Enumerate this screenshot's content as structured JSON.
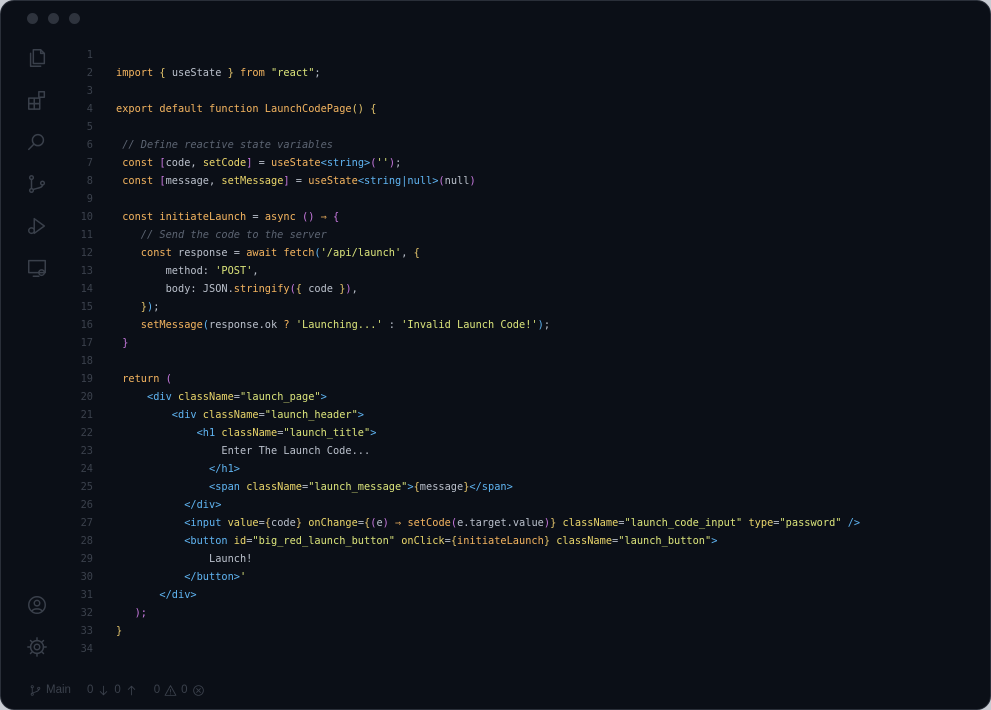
{
  "status": {
    "branch": "Main",
    "incoming": "0",
    "outgoing": "0",
    "warnings": "0",
    "errors": "0"
  },
  "editor": {
    "line_numbers": [
      "1",
      "2",
      "3",
      "4",
      "5",
      "6",
      "7",
      "8",
      "9",
      "10",
      "11",
      "12",
      "13",
      "14",
      "15",
      "16",
      "17",
      "18",
      "19",
      "20",
      "21",
      "22",
      "23",
      "24",
      "25",
      "26",
      "27",
      "28",
      "29",
      "30",
      "31",
      "32",
      "33",
      "34"
    ],
    "lines": [
      [],
      [
        [
          "kw",
          "import "
        ],
        [
          "br1",
          "{ "
        ],
        [
          "pl",
          "useState "
        ],
        [
          "br1",
          "} "
        ],
        [
          "kw",
          "from "
        ],
        [
          "str",
          "\"react\""
        ],
        [
          "pl",
          ";"
        ]
      ],
      [],
      [
        [
          "kw",
          "export default function "
        ],
        [
          "fn",
          "LaunchCodePage"
        ],
        [
          "br1",
          "() {"
        ]
      ],
      [],
      [
        [
          "cmt",
          " // Define reactive state variables"
        ]
      ],
      [
        [
          "kw",
          " const "
        ],
        [
          "br2",
          "["
        ],
        [
          "pl",
          "code, "
        ],
        [
          "attr",
          "setCode"
        ],
        [
          "br2",
          "]"
        ],
        [
          "pl",
          " = "
        ],
        [
          "fn",
          "useState"
        ],
        [
          "type",
          "<string>"
        ],
        [
          "br2",
          "("
        ],
        [
          "str",
          "''"
        ],
        [
          "br2",
          ")"
        ],
        [
          "pl",
          ";"
        ]
      ],
      [
        [
          "kw",
          " const "
        ],
        [
          "br2",
          "["
        ],
        [
          "pl",
          "message, "
        ],
        [
          "attr",
          "setMessage"
        ],
        [
          "br2",
          "]"
        ],
        [
          "pl",
          " = "
        ],
        [
          "fn",
          "useState"
        ],
        [
          "type",
          "<string|null>"
        ],
        [
          "br2",
          "("
        ],
        [
          "pl",
          "null"
        ],
        [
          "br2",
          ")"
        ]
      ],
      [],
      [
        [
          "kw",
          " const "
        ],
        [
          "fn",
          "initiateLaunch"
        ],
        [
          "pl",
          " = "
        ],
        [
          "kw",
          "async "
        ],
        [
          "br2",
          "() "
        ],
        [
          "kw",
          "⇒ "
        ],
        [
          "br2",
          "{"
        ]
      ],
      [
        [
          "cmt",
          "    // Send the code to the server"
        ]
      ],
      [
        [
          "kw",
          "    const "
        ],
        [
          "pl",
          "response = "
        ],
        [
          "kw",
          "await "
        ],
        [
          "fn",
          "fetch"
        ],
        [
          "br3",
          "("
        ],
        [
          "str",
          "'/api/launch'"
        ],
        [
          "pl",
          ", "
        ],
        [
          "br1",
          "{"
        ]
      ],
      [
        [
          "pl",
          "        method: "
        ],
        [
          "str",
          "'POST'"
        ],
        [
          "pl",
          ","
        ]
      ],
      [
        [
          "pl",
          "        body: JSON."
        ],
        [
          "fn",
          "stringify"
        ],
        [
          "br2",
          "("
        ],
        [
          "br1",
          "{ "
        ],
        [
          "pl",
          "code "
        ],
        [
          "br1",
          "}"
        ],
        [
          "br2",
          ")"
        ],
        [
          "pl",
          ","
        ]
      ],
      [
        [
          "br1",
          "    }"
        ],
        [
          "br3",
          ")"
        ],
        [
          "pl",
          ";"
        ]
      ],
      [
        [
          "fn",
          "    setMessage"
        ],
        [
          "br3",
          "("
        ],
        [
          "pl",
          "response.ok "
        ],
        [
          "kw",
          "? "
        ],
        [
          "str",
          "'Launching...'"
        ],
        [
          "pl",
          " : "
        ],
        [
          "str",
          "'Invalid Launch Code!'"
        ],
        [
          "br3",
          ")"
        ],
        [
          "pl",
          ";"
        ]
      ],
      [
        [
          "br2",
          " }"
        ]
      ],
      [],
      [
        [
          "kw",
          " return "
        ],
        [
          "br2",
          "("
        ]
      ],
      [
        [
          "tag",
          "     <div "
        ],
        [
          "attr",
          "className"
        ],
        [
          "pl",
          "="
        ],
        [
          "str",
          "\"launch_page\""
        ],
        [
          "tag",
          ">"
        ]
      ],
      [
        [
          "tag",
          "         <div "
        ],
        [
          "attr",
          "className"
        ],
        [
          "pl",
          "="
        ],
        [
          "str",
          "\"launch_header\""
        ],
        [
          "tag",
          ">"
        ]
      ],
      [
        [
          "tag",
          "             <h1 "
        ],
        [
          "attr",
          "className"
        ],
        [
          "pl",
          "="
        ],
        [
          "str",
          "\"launch_title\""
        ],
        [
          "tag",
          ">"
        ]
      ],
      [
        [
          "pl",
          "                 Enter The Launch Code..."
        ]
      ],
      [
        [
          "tag",
          "               </h1>"
        ]
      ],
      [
        [
          "tag",
          "               <span "
        ],
        [
          "attr",
          "className"
        ],
        [
          "pl",
          "="
        ],
        [
          "str",
          "\"launch_message\""
        ],
        [
          "tag",
          ">"
        ],
        [
          "br1",
          "{"
        ],
        [
          "pl",
          "message"
        ],
        [
          "br1",
          "}"
        ],
        [
          "tag",
          "</span>"
        ]
      ],
      [
        [
          "tag",
          "           </div>"
        ]
      ],
      [
        [
          "tag",
          "           <input "
        ],
        [
          "attr",
          "value"
        ],
        [
          "pl",
          "="
        ],
        [
          "br1",
          "{"
        ],
        [
          "pl",
          "code"
        ],
        [
          "br1",
          "} "
        ],
        [
          "attr",
          "onChange"
        ],
        [
          "pl",
          "="
        ],
        [
          "br1",
          "{"
        ],
        [
          "br2",
          "("
        ],
        [
          "pl",
          "e"
        ],
        [
          "br2",
          ") "
        ],
        [
          "kw",
          "⇒ "
        ],
        [
          "fn",
          "setCode"
        ],
        [
          "br2",
          "("
        ],
        [
          "pl",
          "e.target.value"
        ],
        [
          "br2",
          ")"
        ],
        [
          "br1",
          "} "
        ],
        [
          "attr",
          "className"
        ],
        [
          "pl",
          "="
        ],
        [
          "str",
          "\"launch_code_input\" "
        ],
        [
          "attr",
          "type"
        ],
        [
          "pl",
          "="
        ],
        [
          "str",
          "\"password\" "
        ],
        [
          "tag",
          "/>"
        ]
      ],
      [
        [
          "tag",
          "           <button "
        ],
        [
          "attr",
          "id"
        ],
        [
          "pl",
          "="
        ],
        [
          "str",
          "\"big_red_launch_button\" "
        ],
        [
          "attr",
          "onClick"
        ],
        [
          "pl",
          "="
        ],
        [
          "br1",
          "{"
        ],
        [
          "fn",
          "initiateLaunch"
        ],
        [
          "br1",
          "} "
        ],
        [
          "attr",
          "className"
        ],
        [
          "pl",
          "="
        ],
        [
          "str",
          "\"launch_button\""
        ],
        [
          "tag",
          ">"
        ]
      ],
      [
        [
          "pl",
          "               Launch!"
        ]
      ],
      [
        [
          "tag",
          "           </button>"
        ],
        [
          "str",
          "'"
        ]
      ],
      [
        [
          "tag",
          "       </div>"
        ]
      ],
      [
        [
          "br2",
          "   );"
        ]
      ],
      [
        [
          "br1",
          "}"
        ]
      ],
      []
    ]
  }
}
